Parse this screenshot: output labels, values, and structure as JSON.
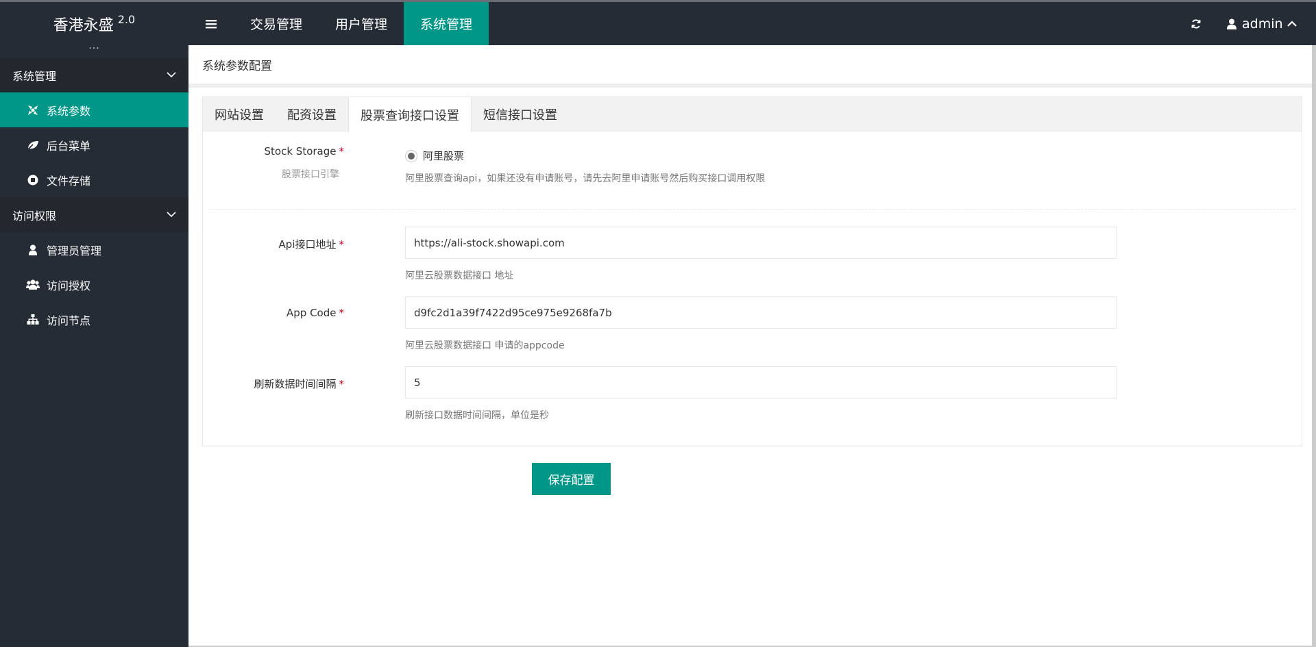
{
  "brand": {
    "name": "香港永盛",
    "version": "2.0"
  },
  "topnav": {
    "items": [
      "交易管理",
      "用户管理",
      "系统管理"
    ],
    "active_index": 2
  },
  "user": {
    "name": "admin"
  },
  "sidebar": {
    "handle": "···",
    "groups": [
      {
        "title": "系统管理",
        "items": [
          {
            "label": "系统参数",
            "icon": "settings-icon",
            "active": true
          },
          {
            "label": "后台菜单",
            "icon": "leaf-icon"
          },
          {
            "label": "文件存储",
            "icon": "circle-stop-icon"
          }
        ]
      },
      {
        "title": "访问权限",
        "items": [
          {
            "label": "管理员管理",
            "icon": "user-icon"
          },
          {
            "label": "访问授权",
            "icon": "users-icon"
          },
          {
            "label": "访问节点",
            "icon": "sitemap-icon"
          }
        ]
      }
    ]
  },
  "page": {
    "title": "系统参数配置"
  },
  "tabs": [
    "网站设置",
    "配资设置",
    "股票查询接口设置",
    "短信接口设置"
  ],
  "active_tab": 2,
  "form": {
    "storage": {
      "label": "Stock Storage",
      "sub_label": "股票接口引擎",
      "option": "阿里股票",
      "help": "阿里股票查询api，如果还没有申请账号，请先去阿里申请账号然后购买接口调用权限"
    },
    "api_url": {
      "label": "Api接口地址",
      "value": "https://ali-stock.showapi.com",
      "help": "阿里云股票数据接口 地址"
    },
    "app_code": {
      "label": "App Code",
      "value": "d9fc2d1a39f7422d95ce975e9268fa7b",
      "help": "阿里云股票数据接口 申请的appcode"
    },
    "interval": {
      "label": "刷新数据时间间隔",
      "value": "5",
      "help": "刷新接口数据时间间隔，单位是秒"
    },
    "required_mark": "*"
  },
  "save_button": "保存配置",
  "colors": {
    "accent": "#009688",
    "sidebar_bg": "#262c36",
    "required": "#d9001b"
  }
}
